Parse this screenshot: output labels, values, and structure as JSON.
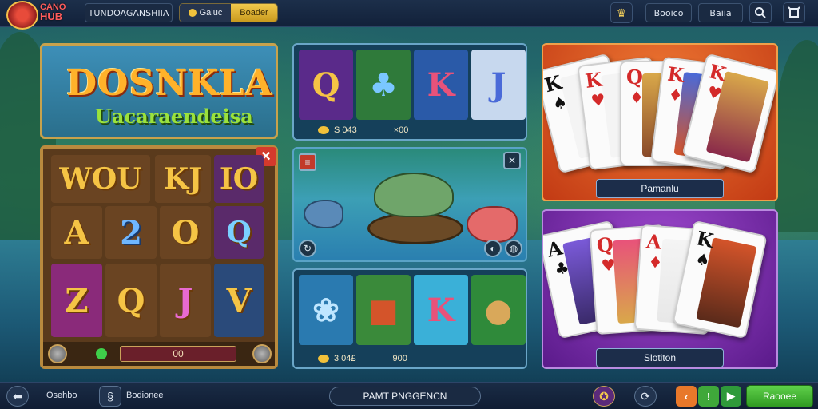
{
  "header": {
    "logo_line1": "CANO",
    "logo_line2": "HUB",
    "game_name": "TUNDOAGANSHIIA",
    "tab_coins": "Gaiuc",
    "tab_active": "Boader",
    "btn_a": "Booico",
    "btn_b": "Baiia"
  },
  "promo": {
    "title": "DOSNKLA",
    "subtitle": "Uacaraendeisa"
  },
  "reel": {
    "rows": [
      [
        "WOU",
        "KJ",
        "IO"
      ],
      [
        "A",
        "2",
        "O",
        "Q"
      ],
      [
        "Z",
        "Q",
        "J",
        "V"
      ]
    ],
    "counter": "00"
  },
  "slots_top": {
    "symbols": [
      "Q",
      "♣",
      "K",
      "J"
    ],
    "bet": "S 043",
    "win": "×00"
  },
  "slots_bottom": {
    "symbols": [
      "❀",
      "■",
      "K",
      "●"
    ],
    "bet": "3 04£",
    "win": "900"
  },
  "cards_top": {
    "label": "Pamanlu",
    "cards": [
      {
        "rank": "K",
        "suit": "♠"
      },
      {
        "rank": "K",
        "suit": "♥"
      },
      {
        "rank": "Q",
        "suit": "♦"
      },
      {
        "rank": "K",
        "suit": "♦"
      },
      {
        "rank": "K",
        "suit": "♥"
      }
    ]
  },
  "cards_bottom": {
    "label": "Slotiton",
    "cards": [
      {
        "rank": "A",
        "suit": "♣"
      },
      {
        "rank": "Q",
        "suit": "♥"
      },
      {
        "rank": "A",
        "suit": "♦"
      },
      {
        "rank": "K",
        "suit": "♠"
      }
    ]
  },
  "footer": {
    "label_a": "Osehbo",
    "label_b": "Bodionee",
    "center": "PAMT PNGGENCN",
    "play": "Raooee"
  },
  "colors": {
    "accent_gold": "#f2c94c",
    "cards_top_bg": "#e0501e",
    "cards_bottom_bg": "#7a2fa8",
    "play_green": "#3fb32e"
  }
}
